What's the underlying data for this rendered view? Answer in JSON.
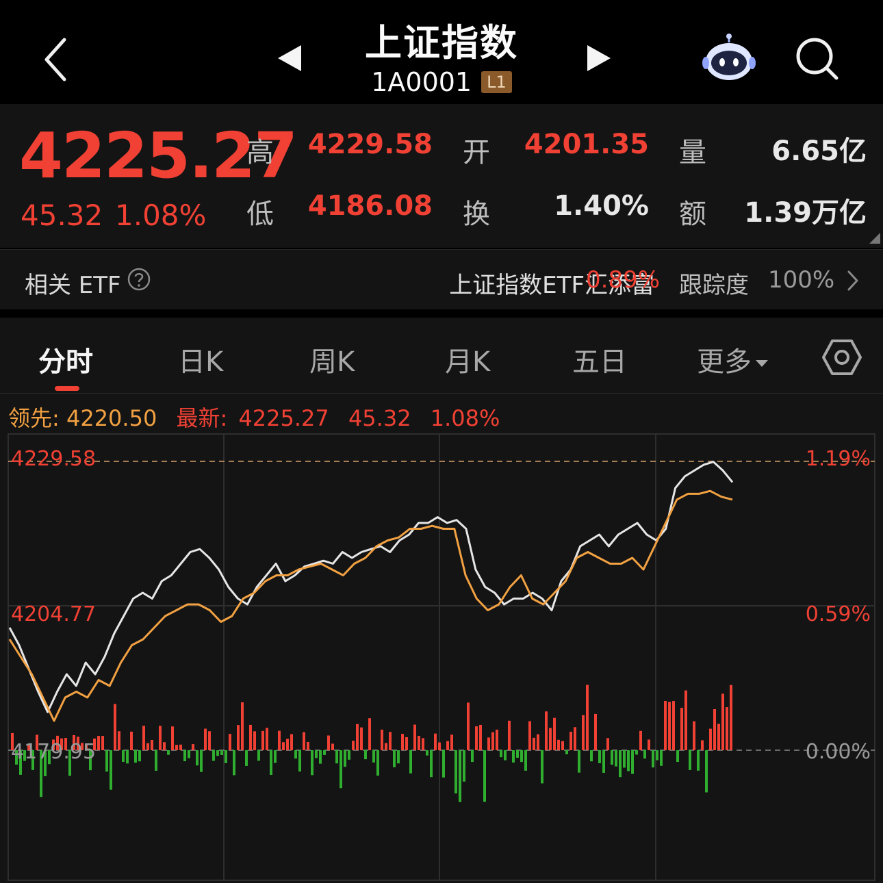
{
  "header": {
    "title": "上证指数",
    "code": "1A0001",
    "level": "L1"
  },
  "icons": {
    "back": "chevron-left-icon",
    "prev": "triangle-left-icon",
    "next": "triangle-right-icon",
    "assistant": "robot-icon",
    "search": "search-icon",
    "help": "question-circle-icon",
    "more": "chevron-right-icon",
    "settings": "hexagon-settings-icon"
  },
  "quote": {
    "last": "4225.27",
    "change": "45.32",
    "change_pct": "1.08%",
    "high_label": "高",
    "high": "4229.58",
    "open_label": "开",
    "open": "4201.35",
    "volume_label": "量",
    "volume": "6.65亿",
    "low_label": "低",
    "low": "4186.08",
    "turnover_label": "换",
    "turnover": "1.40%",
    "amount_label": "额",
    "amount": "1.39万亿"
  },
  "etf": {
    "label": "相关 ETF",
    "name": "上证指数ETF汇添富",
    "change_pct": "0.89%",
    "tracking_label": "跟踪度",
    "tracking_value": "100%"
  },
  "tabs": {
    "items": [
      "分时",
      "日K",
      "周K",
      "月K",
      "五日",
      "更多"
    ],
    "active": "分时"
  },
  "info": {
    "lead_label": "领先:",
    "lead_value": "4220.50",
    "latest_label": "最新:",
    "latest_value": "4225.27",
    "latest_change": "45.32",
    "latest_pct": "1.08%"
  },
  "colors": {
    "up": "#f04134",
    "down": "#2fae2f",
    "leading_line": "#f2a142",
    "price_line": "#e6e6e6",
    "background": "#141414"
  },
  "chart_data": {
    "type": "line",
    "y_ticks_left": [
      "4229.58",
      "4204.77",
      "4179.95"
    ],
    "y_ticks_right": [
      "1.19%",
      "0.59%",
      "0.00%"
    ],
    "prev_close": 4179.95,
    "ylim": [
      4179.95,
      4229.58
    ],
    "grid": true,
    "series": [
      {
        "name": "最新",
        "values": [
          4201,
          4198,
          4194,
          4190,
          4186.5,
          4190,
          4193,
          4191,
          4195,
          4193,
          4196,
          4200,
          4203,
          4206,
          4207,
          4206,
          4209,
          4210,
          4212,
          4214,
          4214.5,
          4213,
          4211,
          4208,
          4206,
          4205,
          4208,
          4210,
          4212,
          4209,
          4210,
          4211.5,
          4212,
          4212.5,
          4212,
          4214,
          4213,
          4214,
          4214.5,
          4215,
          4214,
          4216,
          4217,
          4219,
          4219,
          4220,
          4219,
          4219.5,
          4218,
          4211,
          4208,
          4207,
          4205,
          4206,
          4206,
          4207,
          4206,
          4204,
          4209,
          4211,
          4215,
          4216,
          4217,
          4215,
          4217,
          4218,
          4219,
          4217,
          4216,
          4218,
          4225,
          4227,
          4228,
          4229,
          4229.5,
          4228,
          4226
        ],
        "color": "#e6e6e6"
      },
      {
        "name": "领先",
        "values": [
          4199,
          4196,
          4193,
          4189,
          4185,
          4189,
          4190,
          4189,
          4192,
          4191,
          4195,
          4198,
          4199,
          4201,
          4203,
          4204,
          4205,
          4205,
          4204,
          4202,
          4203,
          4206,
          4207,
          4209,
          4210,
          4210,
          4211,
          4211.5,
          4212,
          4211,
          4210,
          4212,
          4213,
          4215,
          4216,
          4216.5,
          4218,
          4218,
          4218.5,
          4218,
          4218,
          4210,
          4206,
          4204,
          4205,
          4208,
          4210,
          4206,
          4205,
          4207,
          4209,
          4213,
          4214,
          4213,
          4212,
          4212,
          4213,
          4211,
          4215,
          4219,
          4223,
          4224,
          4224,
          4224.5,
          4223.5,
          4223
        ],
        "color": "#f2a142"
      }
    ]
  }
}
